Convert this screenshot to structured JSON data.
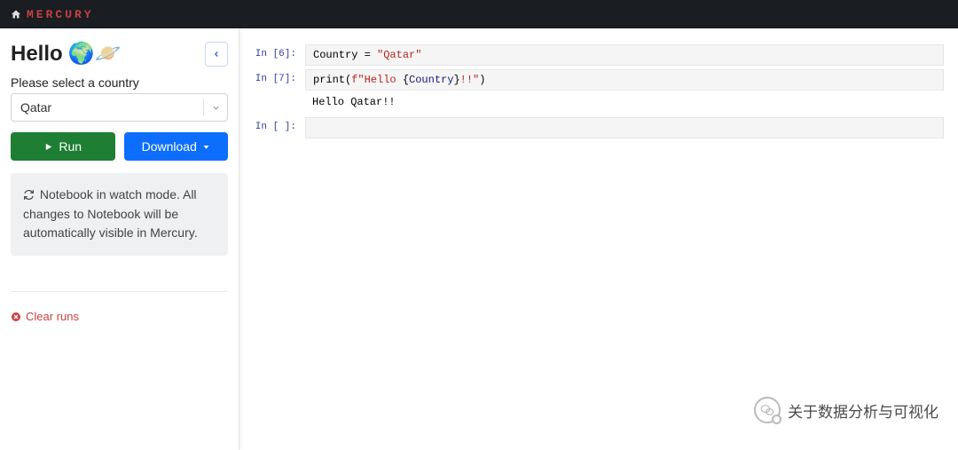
{
  "brand": "MERCURY",
  "sidebar": {
    "title": "Hello",
    "title_emoji": "🌍🪐",
    "country_label": "Please select a country",
    "country_value": "Qatar",
    "run_label": "Run",
    "download_label": "Download",
    "status_text": "Notebook in watch mode. All changes to Notebook will be automatically visible in Mercury.",
    "clear_runs_label": "Clear runs"
  },
  "notebook": {
    "cells": [
      {
        "prompt": "In [6]:",
        "code_html": "Country = <span class='tok-str'>\"Qatar\"</span>"
      },
      {
        "prompt": "In [7]:",
        "code_html": "print(<span class='tok-str'>f\"Hello </span>{<span class='tok-fstr-expr'>Country</span>}<span class='tok-str'>!!\"</span>)",
        "output": "Hello Qatar!!"
      },
      {
        "prompt": "In [ ]:",
        "code_html": " "
      }
    ]
  },
  "watermark": "关于数据分析与可视化"
}
